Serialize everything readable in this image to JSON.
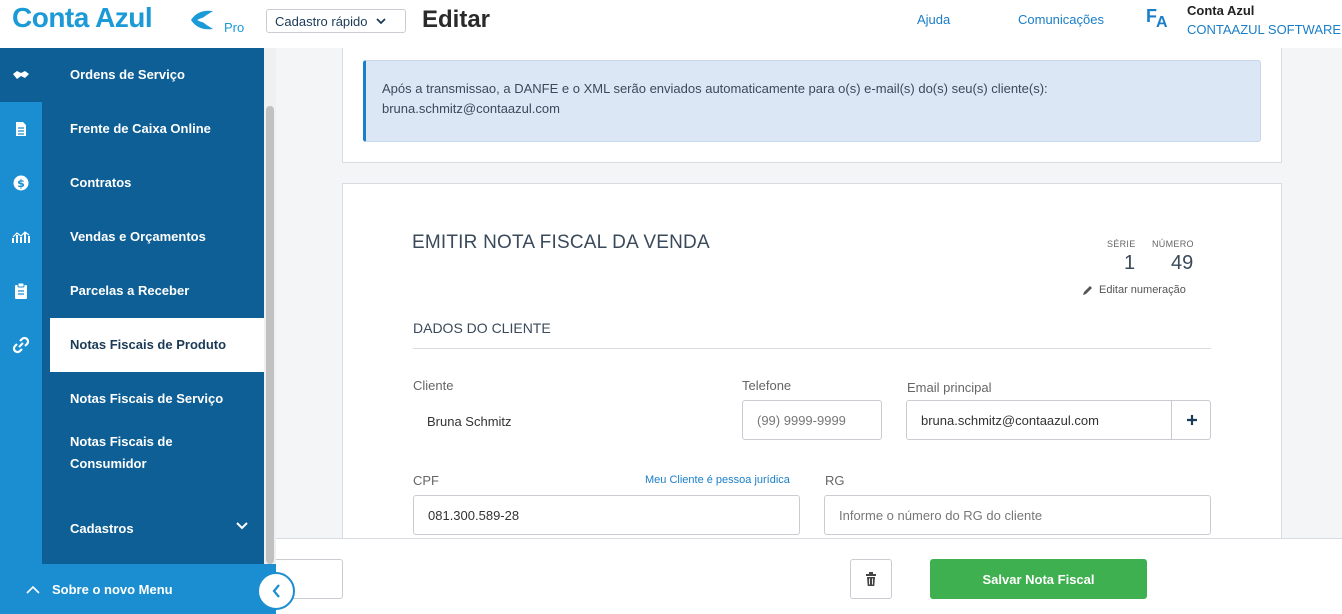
{
  "header": {
    "logo_text": "Conta Azul",
    "logo_badge": "Pro",
    "quick_register_label": "Cadastro rápido",
    "page_title": "Editar",
    "help_label": "Ajuda",
    "communications_label": "Comunicações",
    "avatar_initials_1": "F",
    "avatar_initials_2": "A",
    "company_name": "Conta Azul",
    "company_subtitle": "CONTAAZUL SOFTWARE"
  },
  "sidebar": {
    "items": [
      {
        "label": "Ordens de Serviço"
      },
      {
        "label": "Frente de Caixa Online"
      },
      {
        "label": "Contratos"
      },
      {
        "label": "Vendas e Orçamentos"
      },
      {
        "label": "Parcelas a Receber"
      },
      {
        "label": "Notas Fiscais de Produto",
        "selected": true
      },
      {
        "label": "Notas Fiscais de Serviço"
      },
      {
        "label": "Notas Fiscais de Consumidor"
      },
      {
        "label": "Cadastros"
      }
    ],
    "icons": [
      "handshake-icon",
      "document-icon",
      "dollar-icon",
      "chart-icon",
      "clipboard-icon",
      "link-icon"
    ],
    "new_menu_label": "Sobre o novo Menu"
  },
  "info": {
    "message": "Após a transmissao, a DANFE e o XML serão enviados automaticamente para o(s) e-mail(s) do(s) seu(s) cliente(s):",
    "email": "bruna.schmitz@contaazul.com"
  },
  "form": {
    "title": "EMITIR NOTA FISCAL DA VENDA",
    "serie_label": "SÉRIE",
    "serie_value": "1",
    "numero_label": "NÚMERO",
    "numero_value": "49",
    "edit_numbering_label": "Editar numeração",
    "section_client": "DADOS DO CLIENTE",
    "client_label": "Cliente",
    "client_value": "Bruna Schmitz",
    "phone_label": "Telefone",
    "phone_placeholder": "(99) 9999-9999",
    "email_label": "Email principal",
    "email_value": "bruna.schmitz@contaazul.com",
    "cpf_label": "CPF",
    "cpf_value": "081.300.589-28",
    "juridica_link": "Meu Cliente é pessoa jurídica",
    "rg_label": "RG",
    "rg_placeholder": "Informe o número do RG do cliente"
  },
  "footer": {
    "save_label": "Salvar Nota Fiscal"
  },
  "colors": {
    "brand_blue": "#1a9ad6",
    "sidebar_dark": "#0d5f96",
    "sidebar_light": "#1a8ed0",
    "save_green": "#3fb04f",
    "info_bg": "#dce7f6"
  }
}
